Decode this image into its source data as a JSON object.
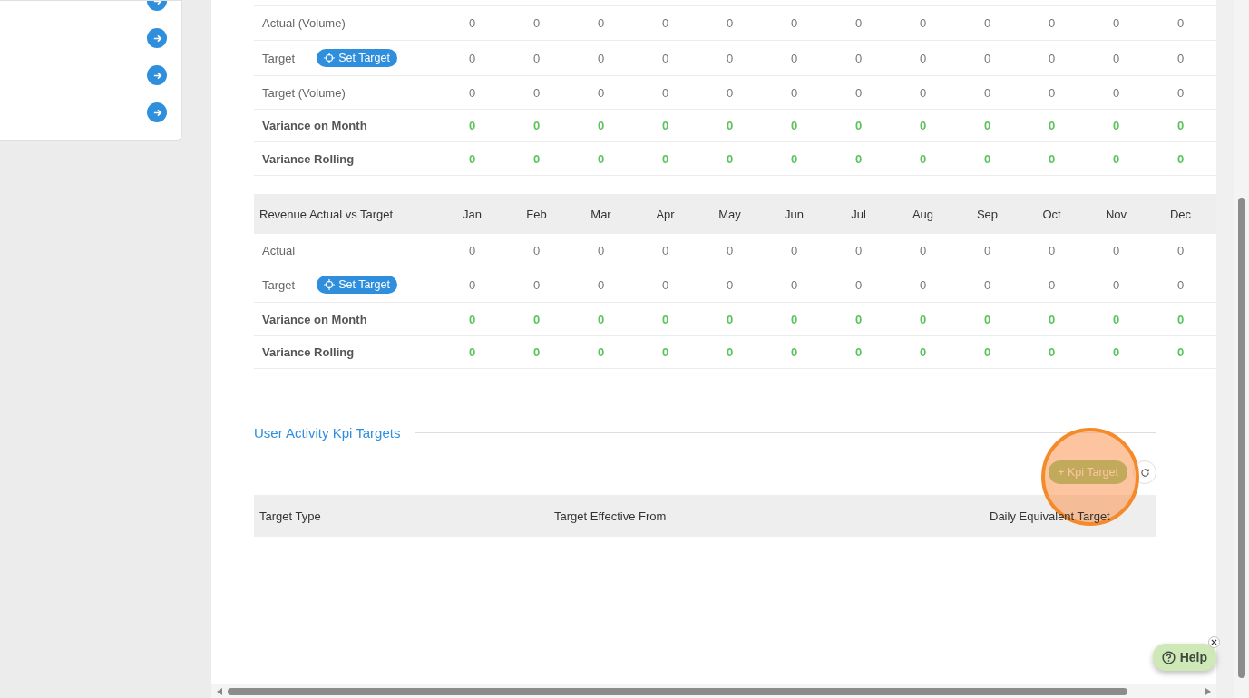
{
  "volume_table": {
    "rows": [
      {
        "label": "Actual (Volume)",
        "kind": "plain",
        "values": [
          "0",
          "0",
          "0",
          "0",
          "0",
          "0",
          "0",
          "0",
          "0",
          "0",
          "0",
          "0"
        ]
      },
      {
        "label": "Target",
        "kind": "plain",
        "action": "Set Target",
        "values": [
          "0",
          "0",
          "0",
          "0",
          "0",
          "0",
          "0",
          "0",
          "0",
          "0",
          "0",
          "0"
        ]
      },
      {
        "label": "Target (Volume)",
        "kind": "plain",
        "values": [
          "0",
          "0",
          "0",
          "0",
          "0",
          "0",
          "0",
          "0",
          "0",
          "0",
          "0",
          "0"
        ]
      },
      {
        "label": "Variance on Month",
        "kind": "variance",
        "values": [
          "0",
          "0",
          "0",
          "0",
          "0",
          "0",
          "0",
          "0",
          "0",
          "0",
          "0",
          "0"
        ]
      },
      {
        "label": "Variance Rolling",
        "kind": "variance",
        "values": [
          "0",
          "0",
          "0",
          "0",
          "0",
          "0",
          "0",
          "0",
          "0",
          "0",
          "0",
          "0"
        ]
      }
    ]
  },
  "revenue_table": {
    "columns": [
      "Revenue Actual vs Target",
      "Jan",
      "Feb",
      "Mar",
      "Apr",
      "May",
      "Jun",
      "Jul",
      "Aug",
      "Sep",
      "Oct",
      "Nov",
      "Dec"
    ],
    "rows": [
      {
        "label": "Actual",
        "kind": "plain",
        "values": [
          "0",
          "0",
          "0",
          "0",
          "0",
          "0",
          "0",
          "0",
          "0",
          "0",
          "0",
          "0"
        ]
      },
      {
        "label": "Target",
        "kind": "plain",
        "action": "Set Target",
        "values": [
          "0",
          "0",
          "0",
          "0",
          "0",
          "0",
          "0",
          "0",
          "0",
          "0",
          "0",
          "0"
        ]
      },
      {
        "label": "Variance on Month",
        "kind": "variance",
        "values": [
          "0",
          "0",
          "0",
          "0",
          "0",
          "0",
          "0",
          "0",
          "0",
          "0",
          "0",
          "0"
        ]
      },
      {
        "label": "Variance Rolling",
        "kind": "variance",
        "values": [
          "0",
          "0",
          "0",
          "0",
          "0",
          "0",
          "0",
          "0",
          "0",
          "0",
          "0",
          "0"
        ]
      }
    ]
  },
  "kpi_section": {
    "title": "User Activity Kpi Targets",
    "add_button": "+ Kpi Target",
    "columns": [
      "Target Type",
      "Target Effective From",
      "Daily Equivalent Target"
    ]
  },
  "help_button": {
    "label": "Help"
  }
}
